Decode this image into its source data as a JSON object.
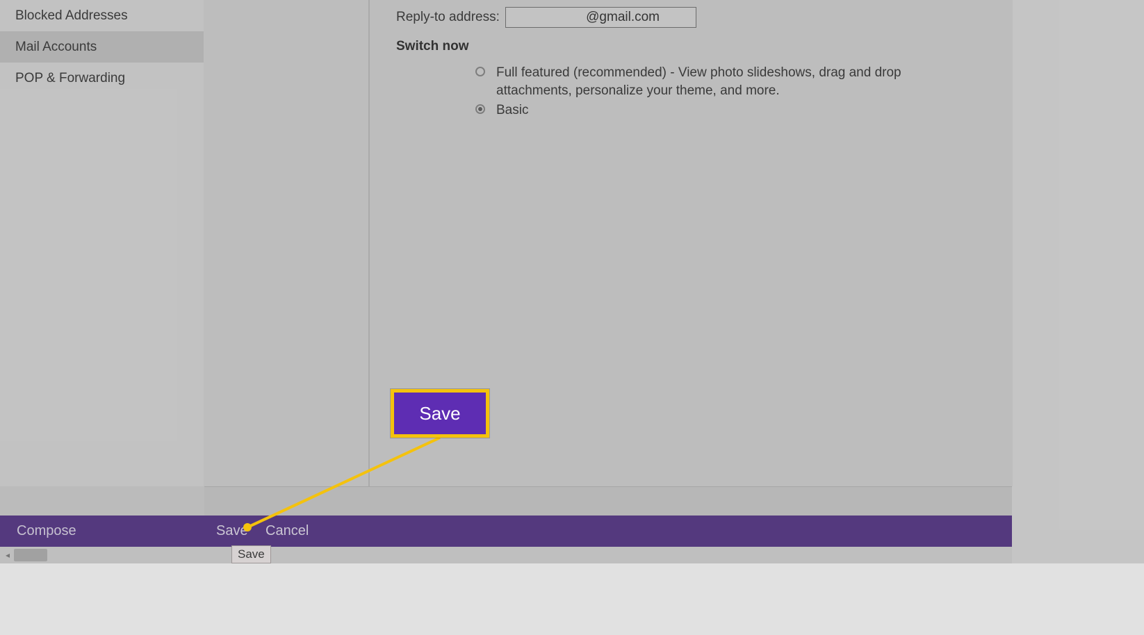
{
  "sidebar": {
    "items": [
      {
        "label": "Blocked Addresses"
      },
      {
        "label": "Mail Accounts"
      },
      {
        "label": "POP & Forwarding"
      }
    ]
  },
  "form": {
    "reply_to_label": "Reply-to address:",
    "reply_to_value": "            @gmail.com",
    "switch_heading": "Switch now",
    "option_full": "Full featured (recommended) - View photo slideshows, drag and drop attachments, personalize your theme, and more.",
    "option_basic": "Basic"
  },
  "callout": {
    "save_label": "Save"
  },
  "footer": {
    "compose": "Compose",
    "save": "Save",
    "cancel": "Cancel"
  },
  "tooltip": {
    "save": "Save"
  },
  "colors": {
    "accent": "#5e2db3",
    "highlight": "#f4c20d"
  }
}
